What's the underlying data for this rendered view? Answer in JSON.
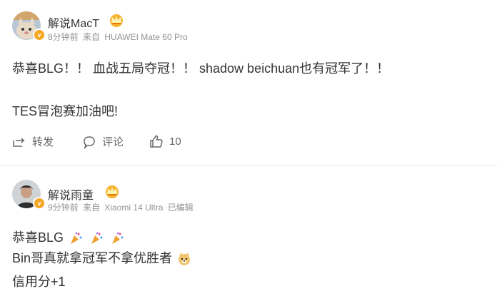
{
  "posts": [
    {
      "author": "解说MacT",
      "time": "8分钟前",
      "source_prefix": "来自",
      "source": "HUAWEI Mate 60 Pro",
      "avatar_text": "黄金猫狗",
      "lines": [
        "恭喜BLG！！ 血战五局夺冠！！ shadow beichuan也有冠军了！！",
        "TES冒泡赛加油吧!"
      ],
      "actions": {
        "repost": "转发",
        "comment": "评论",
        "likes": "10"
      }
    },
    {
      "author": "解说雨童",
      "time": "9分钟前",
      "source_prefix": "来自",
      "source": "Xiaomi 14 Ultra",
      "edited": "已编辑",
      "lines": [
        "恭喜BLG",
        "Bin哥真就拿冠军不拿优胜者",
        "信用分+1"
      ]
    }
  ],
  "colors": {
    "verified": "#f5a623",
    "muted": "#939393",
    "text": "#333333"
  },
  "icons": [
    "verified-badge-icon",
    "crown-icon",
    "repost-icon",
    "comment-icon",
    "like-icon",
    "party-popper-icon",
    "doge-icon"
  ]
}
